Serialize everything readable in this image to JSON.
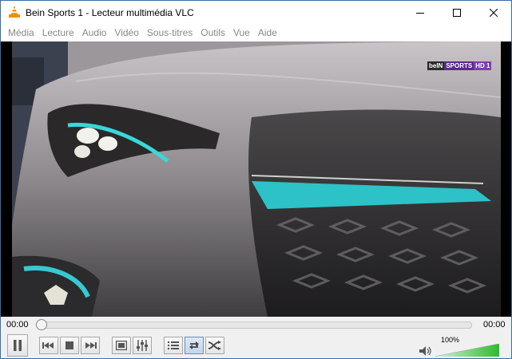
{
  "window": {
    "title": "Bein Sports 1 - Lecteur multimédia VLC"
  },
  "menu": [
    "Média",
    "Lecture",
    "Audio",
    "Vidéo",
    "Sous-titres",
    "Outils",
    "Vue",
    "Aide"
  ],
  "video": {
    "channel_logo": [
      "beIN",
      "SPORTS",
      "HD 1"
    ]
  },
  "seek": {
    "elapsed": "00:00",
    "total": "00:00",
    "position": 0
  },
  "volume": {
    "label": "100%",
    "level": 1.0
  },
  "colors": {
    "menu_text": "#888888",
    "volume_fill": "#3cc13c",
    "vlc_orange": "#f28c00"
  },
  "icons": [
    "vlc-cone-icon",
    "minimize-icon",
    "maximize-icon",
    "close-icon",
    "pause-icon",
    "previous-icon",
    "stop-icon",
    "next-icon",
    "fullscreen-icon",
    "extended-settings-icon",
    "playlist-icon",
    "loop-icon",
    "shuffle-icon",
    "speaker-icon"
  ]
}
